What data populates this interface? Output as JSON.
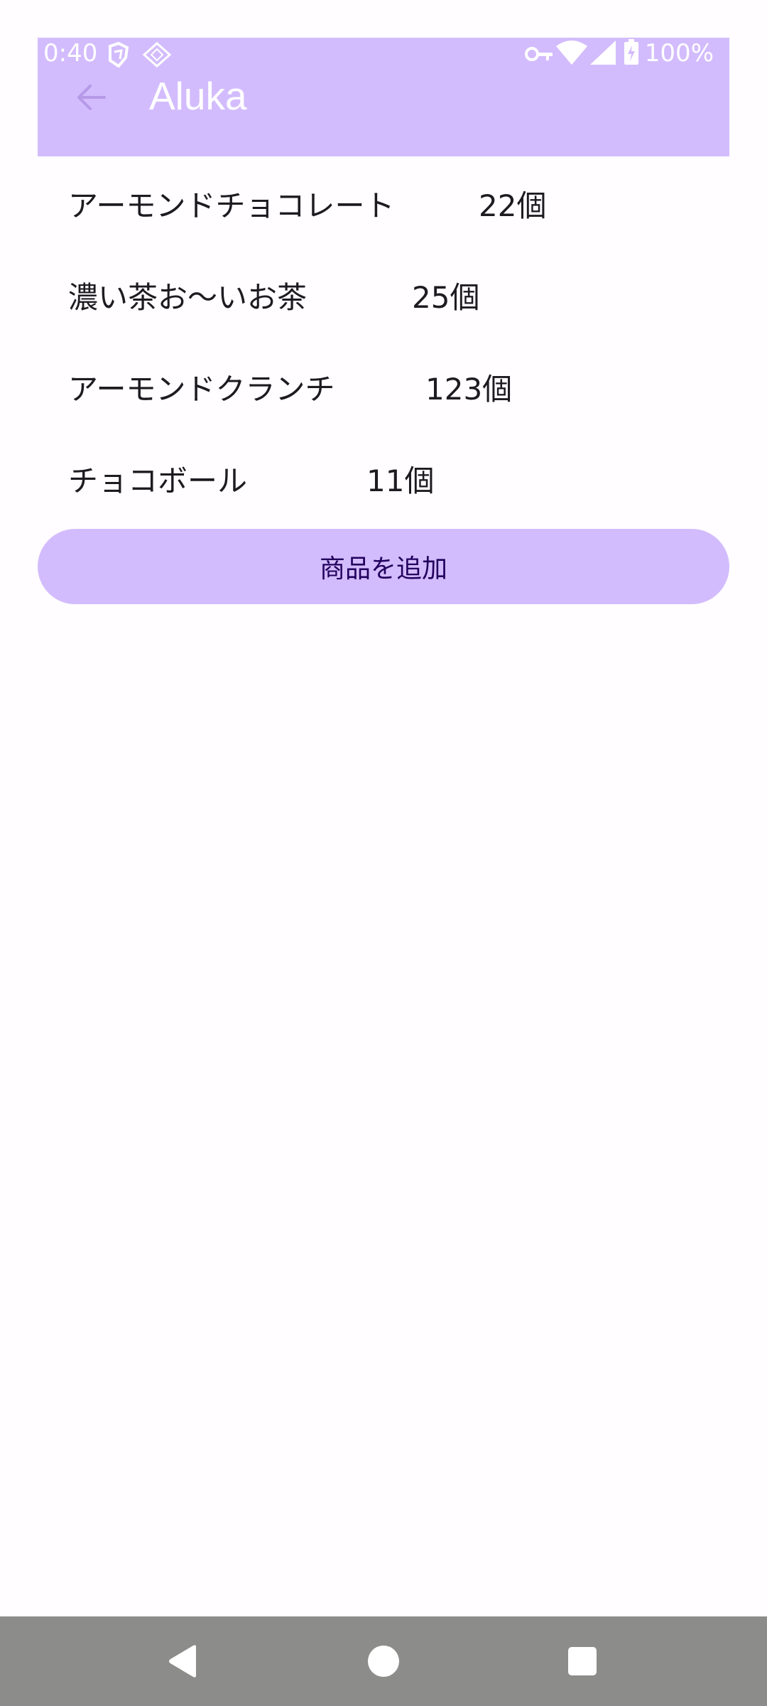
{
  "status_bar": {
    "time": "0:40",
    "battery": "100%"
  },
  "app_bar": {
    "title": "Aluka"
  },
  "items": [
    {
      "name": "アーモンドチョコレート",
      "count": "22個"
    },
    {
      "name": "濃い茶お〜いお茶",
      "count": "25個"
    },
    {
      "name": "アーモンドクランチ",
      "count": "123個"
    },
    {
      "name": "チョコボール",
      "count": "11個"
    }
  ],
  "add_button": {
    "label": "商品を追加"
  },
  "colors": {
    "primary_container": "#d3bcfd",
    "on_primary_container": "#22005d",
    "nav_bar": "#8c8d8a"
  }
}
